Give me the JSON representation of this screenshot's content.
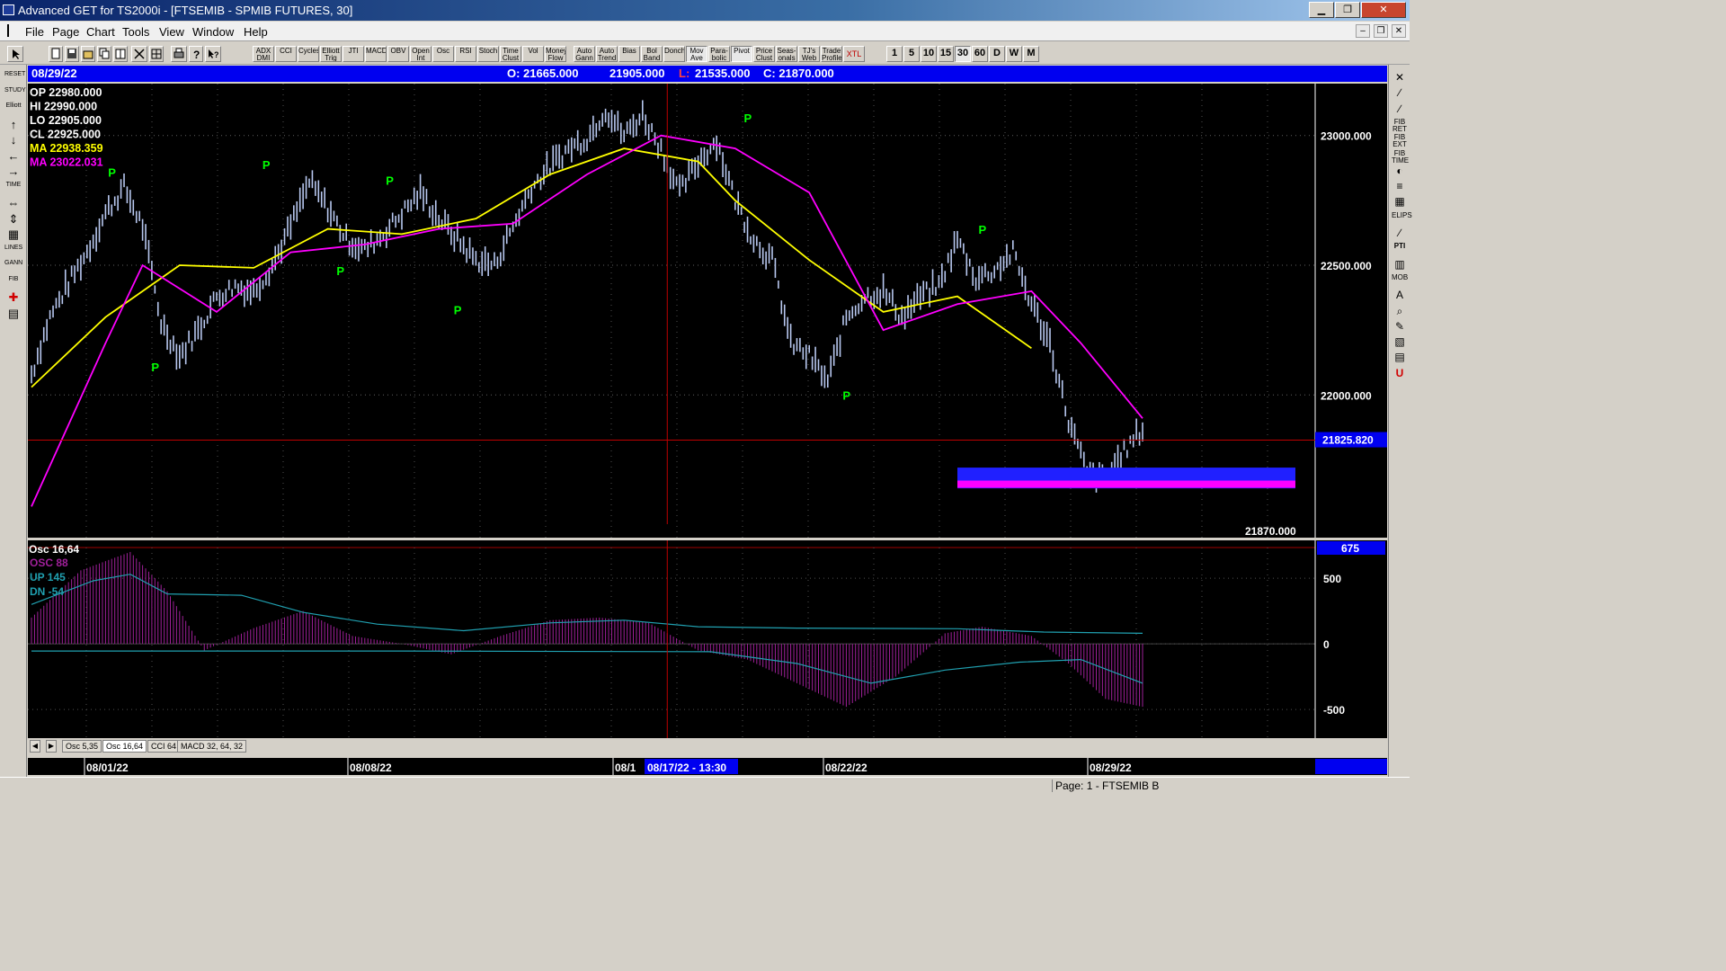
{
  "window": {
    "title": "Advanced GET for TS2000i - [FTSEMIB - SPMIB FUTURES, 30]",
    "minimize": "▁",
    "maximize": "❐",
    "close": "✕"
  },
  "menu": {
    "items": [
      "File",
      "Page",
      "Chart",
      "Tools",
      "View",
      "Window",
      "Help"
    ],
    "mdi_min": "–",
    "mdi_restore": "❐",
    "mdi_close": "✕"
  },
  "toolbar": {
    "tools": [
      "ADX DMI",
      "CCI",
      "Cycles",
      "Elliott Trig",
      "JTI",
      "MACD",
      "OBV",
      "Open Int",
      "Osc",
      "RSI",
      "Stoch",
      "Time Clust",
      "Vol",
      "Money Flow",
      "Auto Gann",
      "Auto Trend",
      "Bias",
      "Bol Band",
      "Donch",
      "Mov Ave",
      "Para-bolic",
      "Pivot",
      "Price Clust",
      "Seas-onals",
      "TJ's Web",
      "Trade Profile",
      "XTL"
    ],
    "intervals": [
      "1",
      "5",
      "10",
      "15",
      "30",
      "60",
      "D",
      "W",
      "M"
    ],
    "selected_interval": "30"
  },
  "left_tools": [
    "RESET",
    "STUDY",
    "Elliott",
    "↑",
    "↓",
    "←",
    "→",
    "TIME",
    "⇔",
    "⇕",
    "▦",
    "LINES",
    "GANN",
    "FIB",
    "✚",
    "▤"
  ],
  "right_tools": [
    "✕",
    "∕",
    "∕",
    "FIB RET",
    "FIB EXT",
    "FIB TIME",
    "◐",
    "≡",
    "▦",
    "ELIPS",
    "∕",
    "PTI",
    "▥",
    "MOB",
    "A",
    "⌕",
    "✎",
    "▧",
    "▤",
    "U"
  ],
  "infobar": {
    "date": "08/29/22",
    "open": "O: 21665.000",
    "high": "21905.000",
    "low_label": "L:",
    "low": "21535.000",
    "close": "C: 21870.000"
  },
  "price_readout": {
    "op": "OP  22980.000",
    "hi": "HI   22990.000",
    "lo": "LO  22905.000",
    "cl": "CL  22925.000",
    "ma1": "MA  22938.359",
    "ma2": "MA  23022.031"
  },
  "price_axis": {
    "ticks": [
      "23000.000",
      "22500.000",
      "22000.000"
    ],
    "cursor_value": "21825.820",
    "last_value": "21870.000"
  },
  "osc": {
    "title": "Osc 16,64",
    "osc": "OSC 88",
    "up": "UP   145",
    "dn": "DN   -54",
    "top_value": "675",
    "ticks": [
      "500",
      "0",
      "-500"
    ]
  },
  "tabs": [
    "Osc 5,35",
    "Osc 16,64",
    "CCI 64",
    "MACD 32, 64, 32"
  ],
  "selected_tab": "Osc 16,64",
  "dates": {
    "d1": "08/01/22",
    "d2": "08/08/22",
    "d3": "08/1",
    "cursor": "08/17/22 - 13:30",
    "d4": "08/22/22",
    "d5": "08/29/22"
  },
  "pivot_label": "P",
  "status": "Page: 1 - FTSEMIB B",
  "colors": {
    "bars": "#b8c8f0",
    "ma_fast": "#ffff00",
    "ma_slow": "#ff00ff",
    "pivot": "#00ff00",
    "cursor": "#c00000",
    "infobar": "#0000f0",
    "osc_hist": "#a0209a",
    "osc_line": "#20a0b0"
  },
  "chart_data": {
    "type": "line",
    "price_series": [
      {
        "x": 0,
        "y": 22080
      },
      {
        "x": 3,
        "y": 22300
      },
      {
        "x": 6,
        "y": 22430
      },
      {
        "x": 9,
        "y": 22550
      },
      {
        "x": 12,
        "y": 22700
      },
      {
        "x": 15,
        "y": 22800
      },
      {
        "x": 18,
        "y": 22650
      },
      {
        "x": 21,
        "y": 22280
      },
      {
        "x": 24,
        "y": 22150
      },
      {
        "x": 27,
        "y": 22250
      },
      {
        "x": 30,
        "y": 22380
      },
      {
        "x": 33,
        "y": 22420
      },
      {
        "x": 36,
        "y": 22400
      },
      {
        "x": 39,
        "y": 22500
      },
      {
        "x": 42,
        "y": 22650
      },
      {
        "x": 45,
        "y": 22820
      },
      {
        "x": 48,
        "y": 22720
      },
      {
        "x": 51,
        "y": 22600
      },
      {
        "x": 54,
        "y": 22560
      },
      {
        "x": 57,
        "y": 22620
      },
      {
        "x": 60,
        "y": 22700
      },
      {
        "x": 63,
        "y": 22780
      },
      {
        "x": 66,
        "y": 22680
      },
      {
        "x": 69,
        "y": 22600
      },
      {
        "x": 72,
        "y": 22520
      },
      {
        "x": 75,
        "y": 22500
      },
      {
        "x": 78,
        "y": 22650
      },
      {
        "x": 81,
        "y": 22800
      },
      {
        "x": 84,
        "y": 22880
      },
      {
        "x": 87,
        "y": 22950
      },
      {
        "x": 90,
        "y": 22990
      },
      {
        "x": 93,
        "y": 23100
      },
      {
        "x": 96,
        "y": 23000
      },
      {
        "x": 99,
        "y": 23080
      },
      {
        "x": 102,
        "y": 22950
      },
      {
        "x": 105,
        "y": 22780
      },
      {
        "x": 108,
        "y": 22900
      },
      {
        "x": 111,
        "y": 22980
      },
      {
        "x": 114,
        "y": 22750
      },
      {
        "x": 117,
        "y": 22600
      },
      {
        "x": 120,
        "y": 22520
      },
      {
        "x": 123,
        "y": 22200
      },
      {
        "x": 126,
        "y": 22150
      },
      {
        "x": 129,
        "y": 22050
      },
      {
        "x": 132,
        "y": 22300
      },
      {
        "x": 135,
        "y": 22380
      },
      {
        "x": 138,
        "y": 22400
      },
      {
        "x": 141,
        "y": 22300
      },
      {
        "x": 144,
        "y": 22380
      },
      {
        "x": 147,
        "y": 22420
      },
      {
        "x": 150,
        "y": 22600
      },
      {
        "x": 153,
        "y": 22450
      },
      {
        "x": 156,
        "y": 22480
      },
      {
        "x": 159,
        "y": 22550
      },
      {
        "x": 162,
        "y": 22350
      },
      {
        "x": 165,
        "y": 22200
      },
      {
        "x": 168,
        "y": 21900
      },
      {
        "x": 171,
        "y": 21700
      },
      {
        "x": 174,
        "y": 21680
      },
      {
        "x": 177,
        "y": 21780
      },
      {
        "x": 180,
        "y": 21870
      }
    ],
    "ma_fast": [
      {
        "x": 0,
        "y": 22030
      },
      {
        "x": 12,
        "y": 22300
      },
      {
        "x": 24,
        "y": 22500
      },
      {
        "x": 36,
        "y": 22490
      },
      {
        "x": 48,
        "y": 22640
      },
      {
        "x": 60,
        "y": 22620
      },
      {
        "x": 72,
        "y": 22680
      },
      {
        "x": 84,
        "y": 22850
      },
      {
        "x": 96,
        "y": 22950
      },
      {
        "x": 108,
        "y": 22900
      },
      {
        "x": 114,
        "y": 22750
      },
      {
        "x": 126,
        "y": 22520
      },
      {
        "x": 138,
        "y": 22320
      },
      {
        "x": 150,
        "y": 22380
      },
      {
        "x": 162,
        "y": 22180
      }
    ],
    "ma_slow": [
      {
        "x": 0,
        "y": 21570
      },
      {
        "x": 12,
        "y": 22200
      },
      {
        "x": 18,
        "y": 22500
      },
      {
        "x": 30,
        "y": 22320
      },
      {
        "x": 42,
        "y": 22550
      },
      {
        "x": 54,
        "y": 22580
      },
      {
        "x": 66,
        "y": 22640
      },
      {
        "x": 78,
        "y": 22660
      },
      {
        "x": 90,
        "y": 22850
      },
      {
        "x": 102,
        "y": 23000
      },
      {
        "x": 114,
        "y": 22950
      },
      {
        "x": 126,
        "y": 22780
      },
      {
        "x": 138,
        "y": 22250
      },
      {
        "x": 150,
        "y": 22350
      },
      {
        "x": 162,
        "y": 22400
      },
      {
        "x": 170,
        "y": 22200
      },
      {
        "x": 180,
        "y": 21910
      }
    ],
    "pivots": [
      {
        "x": 13,
        "y": 22820,
        "pos": "top"
      },
      {
        "x": 20,
        "y": 22140,
        "pos": "bottom"
      },
      {
        "x": 38,
        "y": 22850,
        "pos": "top"
      },
      {
        "x": 50,
        "y": 22510,
        "pos": "bottom"
      },
      {
        "x": 58,
        "y": 22790,
        "pos": "top"
      },
      {
        "x": 69,
        "y": 22360,
        "pos": "bottom"
      },
      {
        "x": 116,
        "y": 23030,
        "pos": "top"
      },
      {
        "x": 132,
        "y": 22030,
        "pos": "bottom"
      },
      {
        "x": 154,
        "y": 22600,
        "pos": "top"
      }
    ],
    "osc_hist": [
      {
        "x": 0,
        "y": 200
      },
      {
        "x": 8,
        "y": 560
      },
      {
        "x": 16,
        "y": 700
      },
      {
        "x": 22,
        "y": 400
      },
      {
        "x": 28,
        "y": -50
      },
      {
        "x": 36,
        "y": 120
      },
      {
        "x": 44,
        "y": 250
      },
      {
        "x": 52,
        "y": 60
      },
      {
        "x": 60,
        "y": 0
      },
      {
        "x": 68,
        "y": -80
      },
      {
        "x": 76,
        "y": 60
      },
      {
        "x": 84,
        "y": 180
      },
      {
        "x": 92,
        "y": 200
      },
      {
        "x": 100,
        "y": 160
      },
      {
        "x": 108,
        "y": -50
      },
      {
        "x": 116,
        "y": -120
      },
      {
        "x": 124,
        "y": -300
      },
      {
        "x": 132,
        "y": -480
      },
      {
        "x": 140,
        "y": -250
      },
      {
        "x": 148,
        "y": 80
      },
      {
        "x": 154,
        "y": 130
      },
      {
        "x": 162,
        "y": 60
      },
      {
        "x": 168,
        "y": -150
      },
      {
        "x": 174,
        "y": -420
      },
      {
        "x": 180,
        "y": -480
      }
    ],
    "osc_up": [
      {
        "x": 0,
        "y": 300
      },
      {
        "x": 10,
        "y": 480
      },
      {
        "x": 16,
        "y": 530
      },
      {
        "x": 22,
        "y": 380
      },
      {
        "x": 34,
        "y": 370
      },
      {
        "x": 44,
        "y": 240
      },
      {
        "x": 56,
        "y": 150
      },
      {
        "x": 70,
        "y": 100
      },
      {
        "x": 84,
        "y": 160
      },
      {
        "x": 96,
        "y": 180
      },
      {
        "x": 108,
        "y": 130
      },
      {
        "x": 124,
        "y": 120
      },
      {
        "x": 150,
        "y": 115
      },
      {
        "x": 164,
        "y": 90
      },
      {
        "x": 180,
        "y": 80
      }
    ],
    "osc_dn": [
      {
        "x": 0,
        "y": -55
      },
      {
        "x": 60,
        "y": -55
      },
      {
        "x": 110,
        "y": -60
      },
      {
        "x": 124,
        "y": -150
      },
      {
        "x": 136,
        "y": -300
      },
      {
        "x": 148,
        "y": -200
      },
      {
        "x": 160,
        "y": -140
      },
      {
        "x": 170,
        "y": -120
      },
      {
        "x": 180,
        "y": -300
      }
    ],
    "x_range": [
      0,
      180
    ],
    "y_range": [
      21450,
      23200
    ],
    "osc_range": [
      -650,
      720
    ],
    "cursor_x": 103,
    "cursor_y": 21825.82,
    "zone": {
      "y1": 21640,
      "y2": 21690
    },
    "grid": true
  }
}
